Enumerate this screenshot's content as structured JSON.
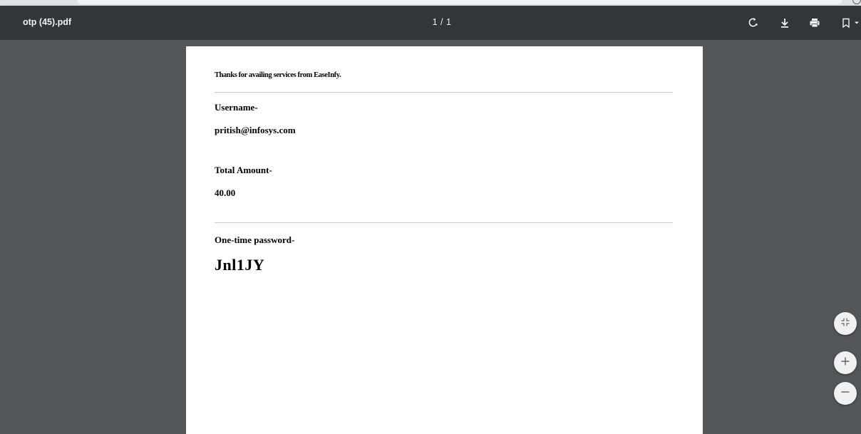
{
  "toolbar": {
    "title": "otp (45).pdf",
    "page_indicator": "1 / 1",
    "icons": [
      "rotate-icon",
      "download-icon",
      "print-icon",
      "bookmark-icon"
    ]
  },
  "document": {
    "thanks_line": "Thanks for availing services from EaseInfy.",
    "username_label": "Username-",
    "username_value": "pritish@infosys.com",
    "total_amount_label": "Total Amount-",
    "total_amount_value": "40.00",
    "otp_label": "One-time password-",
    "otp_value": "Jnl1JY"
  },
  "zoom_controls": {
    "icons": [
      "fit-to-page-icon",
      "zoom-in-icon",
      "zoom-out-icon"
    ]
  },
  "colors": {
    "toolbar_bg": "#323639",
    "viewer_bg": "#525659",
    "page_bg": "#ffffff",
    "toolbar_text": "#f1f1f1"
  }
}
